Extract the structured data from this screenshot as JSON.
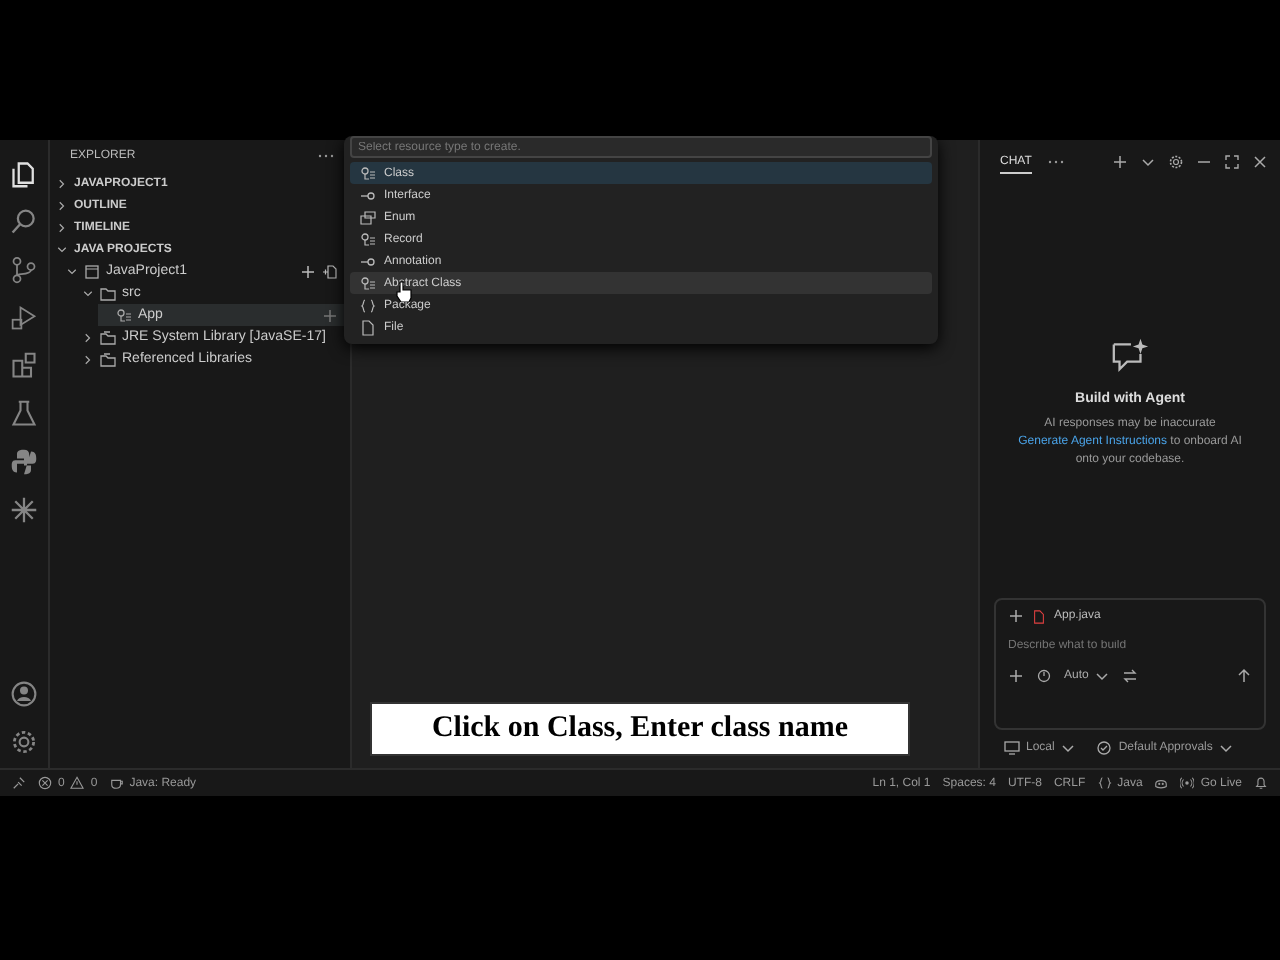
{
  "activity_bar": {
    "items": [
      {
        "kind": "explorer",
        "selected": true
      },
      {
        "kind": "search",
        "selected": false
      },
      {
        "kind": "source-control",
        "selected": false
      },
      {
        "kind": "run",
        "selected": false
      },
      {
        "kind": "extensions",
        "selected": false
      },
      {
        "kind": "testing",
        "selected": false
      },
      {
        "kind": "python",
        "selected": false
      },
      {
        "kind": "spark",
        "selected": false
      }
    ],
    "bottom_items": [
      {
        "kind": "account",
        "selected": false
      },
      {
        "kind": "settings",
        "selected": false
      }
    ]
  },
  "sidebar": {
    "title": "EXPLORER",
    "sections": [
      {
        "label": "JAVAPROJECT1",
        "expanded": false
      },
      {
        "label": "OUTLINE",
        "expanded": false
      },
      {
        "label": "TIMELINE",
        "expanded": false
      },
      {
        "label": "JAVA PROJECTS",
        "expanded": true,
        "tree": [
          {
            "label": "JavaProject1",
            "kind": "project",
            "expanded": true,
            "selected": false,
            "children": [
              {
                "label": "src",
                "kind": "folder",
                "expanded": true,
                "selected": false,
                "children": [
                  {
                    "label": "App",
                    "kind": "class",
                    "selected": true
                  }
                ]
              },
              {
                "label": "JRE System Library [JavaSE-17]",
                "kind": "library",
                "expanded": false,
                "selected": false
              },
              {
                "label": "Referenced Libraries",
                "kind": "library",
                "expanded": false,
                "selected": false
              }
            ]
          }
        ]
      }
    ]
  },
  "quick_pick": {
    "placeholder": "Select resource type to create.",
    "items": [
      {
        "label": "Class",
        "kind": "class",
        "selected": true,
        "hovered": false
      },
      {
        "label": "Interface",
        "kind": "interface",
        "selected": false,
        "hovered": false
      },
      {
        "label": "Enum",
        "kind": "enum",
        "selected": false,
        "hovered": false
      },
      {
        "label": "Record",
        "kind": "class",
        "selected": false,
        "hovered": false
      },
      {
        "label": "Annotation",
        "kind": "interface",
        "selected": false,
        "hovered": false
      },
      {
        "label": "Abstract Class",
        "kind": "class",
        "selected": false,
        "hovered": true
      },
      {
        "label": "Package",
        "kind": "package",
        "selected": false,
        "hovered": false
      },
      {
        "label": "File",
        "kind": "file",
        "selected": false,
        "hovered": false
      }
    ]
  },
  "chat": {
    "tab": "CHAT",
    "empty_title": "Build with Agent",
    "empty_text": "AI responses may be inaccurate",
    "link": "Generate Agent Instructions",
    "empty_text_end": "to onboard AI onto your codebase.",
    "attachment": "App.java",
    "input_placeholder": "Describe what to build",
    "mode": "Auto",
    "target": "Local",
    "approvals": "Default Approvals"
  },
  "status_bar": {
    "errors": "0",
    "warnings": "0",
    "java_status": "Java: Ready",
    "position": "Ln 1, Col 1",
    "spaces": "Spaces: 4",
    "encoding": "UTF-8",
    "eol": "CRLF",
    "language": "Java",
    "go_live": "Go Live"
  },
  "caption": {
    "text": "Click on Class, Enter class name"
  }
}
